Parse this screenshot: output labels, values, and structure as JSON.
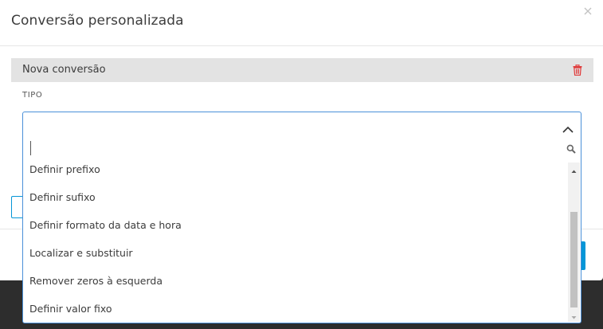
{
  "modal": {
    "title": "Conversão personalizada",
    "close_icon": "close-icon"
  },
  "section": {
    "title": "Nova conversão",
    "delete_icon": "trash-icon",
    "delete_color": "#e03a3a"
  },
  "field": {
    "label": "TIPO"
  },
  "dropdown": {
    "search_value": "",
    "search_placeholder": "",
    "options": [
      {
        "label": "Definir prefixo"
      },
      {
        "label": "Definir sufixo"
      },
      {
        "label": "Definir formato da data e hora"
      },
      {
        "label": "Localizar e substituir"
      },
      {
        "label": "Remover zeros à esquerda"
      },
      {
        "label": "Definir valor fixo"
      }
    ]
  },
  "colors": {
    "accent": "#0696d7",
    "focus_border": "#4a90d9",
    "section_bg": "#e3e3e3",
    "backdrop": "#2d2d2d"
  }
}
